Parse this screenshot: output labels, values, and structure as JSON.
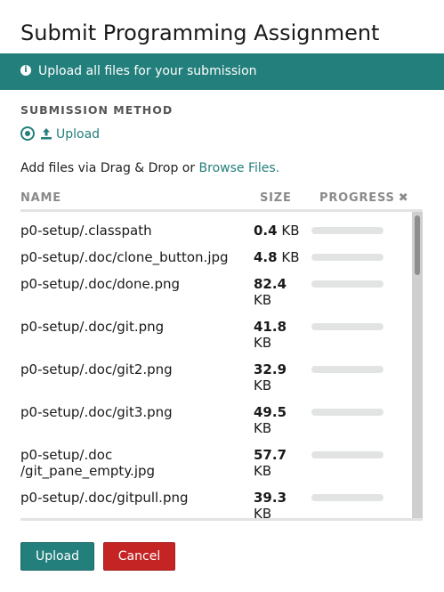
{
  "dialog": {
    "title": "Submit Programming Assignment"
  },
  "banner": {
    "icon": "info-icon",
    "text": "Upload all files for your submission"
  },
  "submission_method": {
    "heading": "SUBMISSION METHOD",
    "option": {
      "label": "Upload",
      "selected": true,
      "icon": "upload-icon"
    }
  },
  "add_files": {
    "text": "Add files via Drag & Drop or ",
    "link": "Browse Files."
  },
  "table": {
    "headers": {
      "name": "NAME",
      "size": "SIZE",
      "progress": "PROGRESS",
      "clear_icon": "✖"
    },
    "rows": [
      {
        "name": [
          "p0-setup/.classpath"
        ],
        "size_value": "0.4",
        "size_unit": "KB",
        "size_wrapped": false,
        "progress": 0
      },
      {
        "name": [
          "p0-setup/.doc/clone_button.jpg"
        ],
        "size_value": "4.8",
        "size_unit": "KB",
        "size_wrapped": false,
        "progress": 0
      },
      {
        "name": [
          "p0-setup/.doc/done.png"
        ],
        "size_value": "82.4",
        "size_unit": "KB",
        "size_wrapped": true,
        "progress": 0
      },
      {
        "name": [
          "p0-setup/.doc/git.png"
        ],
        "size_value": "41.8",
        "size_unit": "KB",
        "size_wrapped": true,
        "progress": 0
      },
      {
        "name": [
          "p0-setup/.doc/git2.png"
        ],
        "size_value": "32.9",
        "size_unit": "KB",
        "size_wrapped": true,
        "progress": 0
      },
      {
        "name": [
          "p0-setup/.doc/git3.png"
        ],
        "size_value": "49.5",
        "size_unit": "KB",
        "size_wrapped": true,
        "progress": 0
      },
      {
        "name": [
          "p0-setup/.doc",
          "/git_pane_empty.jpg"
        ],
        "size_value": "57.7",
        "size_unit": "KB",
        "size_wrapped": true,
        "progress": 0
      },
      {
        "name": [
          "p0-setup/.doc/gitpull.png"
        ],
        "size_value": "39.3",
        "size_unit": "KB",
        "size_wrapped": true,
        "progress": 0
      }
    ]
  },
  "buttons": {
    "upload": "Upload",
    "cancel": "Cancel"
  },
  "colors": {
    "accent": "#237f7c",
    "danger": "#c42424",
    "track": "#e2e4e4"
  }
}
